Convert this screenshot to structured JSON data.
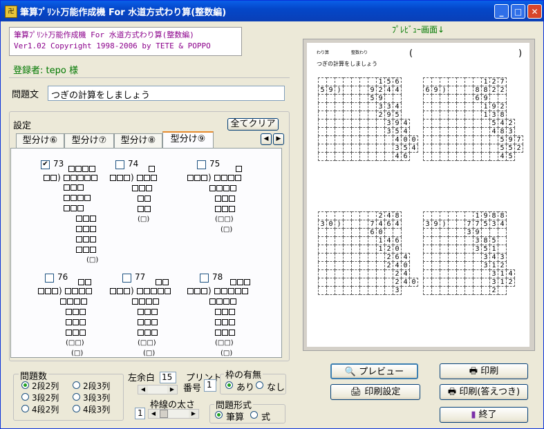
{
  "window": {
    "title": "筆算ﾌﾟﾘﾝﾄ万能作成機 For 水道方式わり算(整数編)",
    "app_icon_text": "卍"
  },
  "info": {
    "line1": "筆算ﾌﾟﾘﾝﾄ万能作成機 For 水道方式わり算(整数編)",
    "line2": "Ver1.02 Copyright 1998-2006 by TETE & POPPO"
  },
  "registered": "登録者: tepo 様",
  "question": {
    "label": "問題文",
    "value": "つぎの計算をしましょう"
  },
  "settings": {
    "label": "設定",
    "clear_all": "全てクリア",
    "tabs": [
      "型分け⑥",
      "型分け⑦",
      "型分け⑧",
      "型分け⑨"
    ],
    "active_tab": 3,
    "patterns": [
      {
        "num": "73",
        "checked": true,
        "check_mark": "✔"
      },
      {
        "num": "74",
        "checked": false
      },
      {
        "num": "75",
        "checked": false
      },
      {
        "num": "76",
        "checked": false
      },
      {
        "num": "77",
        "checked": false
      },
      {
        "num": "78",
        "checked": false
      }
    ],
    "paren1": "(□)",
    "paren2": "(□□)"
  },
  "count": {
    "label": "問題数",
    "options": [
      "2段2列",
      "2段3列",
      "3段2列",
      "3段3列",
      "4段2列",
      "4段3列"
    ],
    "selected": 0
  },
  "margin": {
    "label": "左余白",
    "value": "15"
  },
  "print_no": {
    "label1": "プリント",
    "label2": "番号",
    "value": "1"
  },
  "frame": {
    "label": "枠の有無",
    "on": "あり",
    "off": "なし",
    "selected": "on"
  },
  "line_width": {
    "label": "枠線の太さ",
    "value": "1"
  },
  "format": {
    "label": "問題形式",
    "a": "筆算",
    "b": "式",
    "selected": "a"
  },
  "preview": {
    "header": "ﾌﾟﾚﾋﾞｭｰ画面↓",
    "small1": "わり算",
    "small2": "整数わり",
    "paren_open": "(",
    "paren_close": ")",
    "instruction": "つぎの計算をしましょう",
    "problems": [
      {
        "divisor": "59",
        "dividend": "9244",
        "quotient": "156",
        "steps": [
          "59",
          "334",
          "295",
          "394",
          "354",
          "400",
          "354",
          "46"
        ]
      },
      {
        "divisor": "69",
        "dividend": "8822",
        "quotient": "127",
        "steps": [
          "69",
          "192",
          "138",
          "542",
          "483",
          "597",
          "552",
          "45"
        ]
      },
      {
        "divisor": "30",
        "dividend": "7464",
        "quotient": "248",
        "steps": [
          "60",
          "146",
          "120",
          "264",
          "240",
          "24",
          "240",
          "3"
        ]
      },
      {
        "divisor": "39",
        "dividend": "77534",
        "quotient": "1988",
        "steps": [
          "39",
          "385",
          "351",
          "343",
          "312",
          "314",
          "312",
          "2"
        ]
      }
    ]
  },
  "buttons": {
    "preview": "プレビュー",
    "print": "印刷",
    "print_settings": "印刷設定",
    "print_answers": "印刷(答えつき)",
    "exit": "終了"
  },
  "colors": {
    "green_text": "#007800",
    "info_text": "#8b008b",
    "title_bar": "#0a5fe8"
  }
}
